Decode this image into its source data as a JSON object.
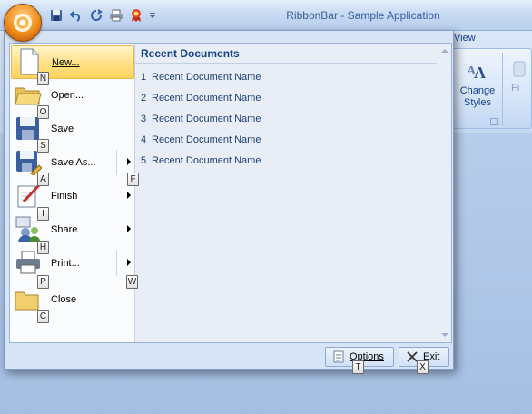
{
  "window": {
    "title_app": "RibbonBar",
    "title_sep": " - ",
    "title_doc": "Sample Application"
  },
  "quick_access": [
    {
      "icon": "save-icon"
    },
    {
      "icon": "undo-icon"
    },
    {
      "icon": "redo-icon"
    },
    {
      "icon": "print-icon"
    },
    {
      "icon": "ribbon-award-icon"
    },
    {
      "icon": "customize-dropdown-icon"
    }
  ],
  "ribbon": {
    "tab_view": "View",
    "change_styles_line1": "Change",
    "change_styles_line2": "Styles",
    "find_label": "Fi"
  },
  "menu": {
    "items": [
      {
        "label": "New...",
        "keytip": "N",
        "icon": "new-document-icon",
        "has_submenu": false,
        "active": true
      },
      {
        "label": "Open...",
        "keytip": "O",
        "icon": "open-folder-icon",
        "has_submenu": false
      },
      {
        "label": "Save",
        "keytip": "S",
        "icon": "save-disk-icon",
        "has_submenu": false
      },
      {
        "label": "Save As...",
        "keytip": "A",
        "icon": "save-as-icon",
        "has_submenu": true,
        "submenu_keytip": "F"
      },
      {
        "label": "Finish",
        "keytip": "I",
        "icon": "finish-icon",
        "has_submenu": true
      },
      {
        "label": "Share",
        "keytip": "H",
        "icon": "share-icon",
        "has_submenu": true
      },
      {
        "label": "Print...",
        "keytip": "P",
        "icon": "printer-icon",
        "has_submenu": true,
        "submenu_keytip": "W"
      },
      {
        "label": "Close",
        "keytip": "C",
        "icon": "close-folder-icon",
        "has_submenu": false
      }
    ],
    "recent_header": "Recent Documents",
    "recent": [
      {
        "num": "1",
        "name": "Recent Document Name"
      },
      {
        "num": "2",
        "name": "Recent Document Name"
      },
      {
        "num": "3",
        "name": "Recent Document Name"
      },
      {
        "num": "4",
        "name": "Recent Document Name"
      },
      {
        "num": "5",
        "name": "Recent Document Name"
      }
    ],
    "options_label": "Options",
    "options_keytip": "T",
    "exit_label": "Exit",
    "exit_keytip": "X"
  },
  "colors": {
    "accent": "#15428b",
    "orb": "#f08b1a",
    "highlight": "#ffd35c"
  }
}
